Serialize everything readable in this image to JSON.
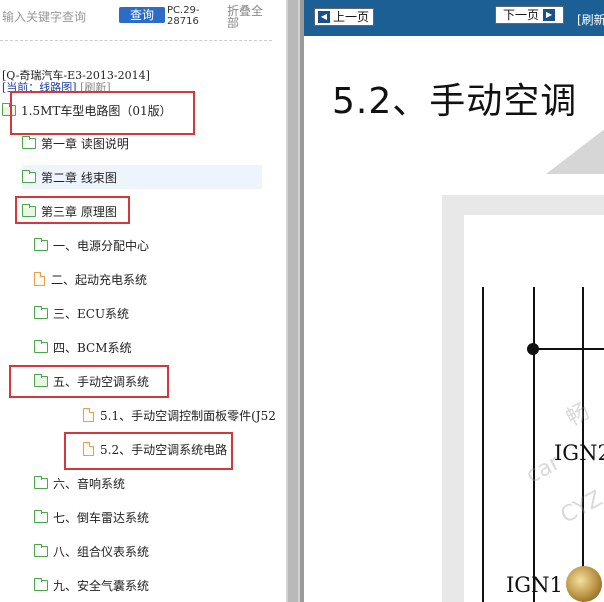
{
  "search": {
    "placeholder": "输入关键字查询",
    "query_label": "查询",
    "code": "PC.29-28716",
    "collapse_label": "折叠全部"
  },
  "breadcrumb": {
    "path": "[Q-奇瑞汽车-E3-2013-2014]",
    "current": "[当前：线路图]",
    "refresh": "[刷新]"
  },
  "tree": [
    {
      "label": "1.5MT车型电路图（01版）",
      "icon": "folder-open-icon"
    },
    {
      "label": "第一章 读图说明",
      "icon": "folder-icon"
    },
    {
      "label": "第二章 线束图",
      "icon": "folder-icon"
    },
    {
      "label": "第三章 原理图",
      "icon": "folder-open-icon"
    },
    {
      "label": "一、电源分配中心",
      "icon": "folder-icon"
    },
    {
      "label": "二、起动充电系统",
      "icon": "file-icon"
    },
    {
      "label": "三、ECU系统",
      "icon": "folder-icon"
    },
    {
      "label": "四、BCM系统",
      "icon": "folder-icon"
    },
    {
      "label": "五、手动空调系统",
      "icon": "folder-open-icon"
    },
    {
      "label": "5.1、手动空调控制面板零件(J52",
      "icon": "file-icon"
    },
    {
      "label": "5.2、手动空调系统电路",
      "icon": "file-icon"
    },
    {
      "label": "六、音响系统",
      "icon": "folder-icon"
    },
    {
      "label": "七、倒车雷达系统",
      "icon": "folder-icon"
    },
    {
      "label": "八、组合仪表系统",
      "icon": "folder-icon"
    },
    {
      "label": "九、安全气囊系统",
      "icon": "folder-icon"
    }
  ],
  "viewer": {
    "prev_label": "上一页",
    "next_label": "下一页",
    "refresh_label": "[刷新",
    "title": "5.2、手动空调",
    "wire_label_1": "IGN2",
    "wire_label_2": "IGN1",
    "watermark_1": "畅",
    "watermark_2": "car",
    "watermark_3": "CYZ"
  },
  "colors": {
    "highlight": "#d3393c",
    "topbar": "#1b5f94",
    "query_button": "#2a6cc6"
  }
}
